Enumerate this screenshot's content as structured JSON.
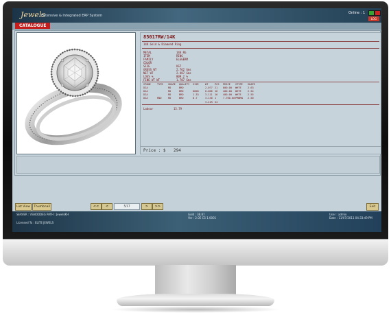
{
  "app": {
    "logo_text": "Jewels",
    "tagline": "Extensive & Integrated ERP System",
    "online_label": "Online : 1",
    "logout_label": "LOG"
  },
  "section_tab": "CATALOGUE",
  "product": {
    "code": "85017RW/14K",
    "description": "14K Gold & Diamond Ring",
    "attributes": [
      {
        "label": "METAL",
        "value": "14K RG"
      },
      {
        "label": "ITEM",
        "value": "RING"
      },
      {
        "label": "FAMILY",
        "value": "ELEGERM"
      },
      {
        "label": "COLOR",
        "value": ""
      },
      {
        "label": "SIZE",
        "value": "US7"
      },
      {
        "label": "GROSS WT",
        "value": "2.762 Gms"
      },
      {
        "label": "NET WT",
        "value": "2.487 Gms"
      },
      {
        "label": "LOSS %",
        "value": "809.2 %"
      },
      {
        "label": "FINE WT WT",
        "value": "1.707 Gms"
      }
    ],
    "stone_headers": [
      "STONE",
      "TYPE",
      "SHAPE",
      "QUALITY",
      "SIZE",
      "WT",
      "PCS",
      "PRICE",
      "STYPE",
      "SHAPE"
    ],
    "stone_rows": [
      [
        "DIA",
        "",
        "RD",
        "BRD",
        "",
        "2.077",
        "21",
        "800.00",
        "WHTE",
        "2.63"
      ],
      [
        "DIA",
        "",
        "RD",
        "BRD",
        "0000",
        "0.066",
        "16",
        "400.00",
        "WHTE",
        "2.54"
      ],
      [
        "DIA",
        "",
        "RD",
        "BRD",
        "1.33",
        "3.111",
        "16",
        "400.00",
        "WHTE",
        "2.55"
      ],
      [
        "DIA",
        "RND",
        "RD",
        "BRD",
        "8.7",
        "3.130",
        "1",
        "7.760.00",
        "PMWRN",
        "2.50"
      ]
    ],
    "stone_total": [
      "",
      "",
      "",
      "",
      "",
      "3.41R",
      "54",
      "",
      "",
      ""
    ],
    "labour_label": "Labour",
    "labour_value": "15.79",
    "price_label": "Price : $",
    "price_value": "294"
  },
  "toolbar": {
    "list_view": "List View",
    "thumbnail": "Thumbnail",
    "first": "<<",
    "prev": "<",
    "page": "5/17",
    "next": ">",
    "last": ">>",
    "exit": "Exit"
  },
  "status": {
    "server": "SERVER : VSNODDEG  PATH : JewelsKH",
    "licensed": "Licensed To : ELITE JEWELS",
    "gold": "Gold : 38.87",
    "user": "User : admin",
    "version": "Ver : 2.0E  C5 1.0001",
    "date": "Date : 11/07/2011  04:33:49 PM"
  },
  "colors": {
    "accent_red": "#c61c1c",
    "button_gold": "#d9c98f",
    "text_maroon": "#7a1111",
    "statusbar": "#2e4d63"
  },
  "icons": [
    "ring-image",
    "minimize-icon",
    "close-icon"
  ]
}
